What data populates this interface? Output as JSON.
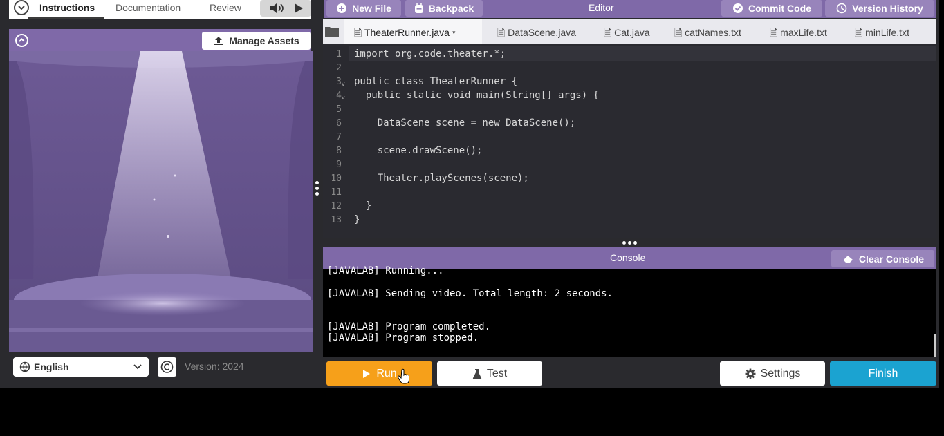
{
  "instructions_panel": {
    "tabs": [
      "Instructions",
      "Documentation",
      "Review"
    ],
    "manage_assets_label": "Manage Assets",
    "language": "English",
    "version": "Version: 2024"
  },
  "editor": {
    "new_file_label": "New File",
    "backpack_label": "Backpack",
    "title": "Editor",
    "commit_code_label": "Commit Code",
    "version_history_label": "Version History",
    "file_tabs": [
      "TheaterRunner.java",
      "DataScene.java",
      "Cat.java",
      "catNames.txt",
      "maxLife.txt",
      "minLife.txt"
    ],
    "line_numbers": [
      "1",
      "2",
      "3",
      "4",
      "5",
      "6",
      "7",
      "8",
      "9",
      "10",
      "11",
      "12",
      "13"
    ],
    "code_lines": [
      "import org.code.theater.*;",
      "",
      "public class TheaterRunner {",
      "  public static void main(String[] args) {",
      "",
      "    DataScene scene = new DataScene();",
      "",
      "    scene.drawScene();",
      "",
      "    Theater.playScenes(scene);",
      "",
      "  }",
      "}"
    ]
  },
  "console": {
    "title": "Console",
    "clear_label": "Clear Console",
    "lines": [
      "[JAVALAB] Running...",
      "[JAVALAB] Sending video. Total length: 2 seconds.",
      "[JAVALAB] Program completed.",
      "[JAVALAB] Program stopped."
    ]
  },
  "bottom_bar": {
    "run_label": "Run",
    "test_label": "Test",
    "settings_label": "Settings",
    "finish_label": "Finish"
  },
  "colors": {
    "purple_header": "#7f69a8",
    "run_orange": "#f6a01a",
    "finish_blue": "#1ba3d1"
  }
}
